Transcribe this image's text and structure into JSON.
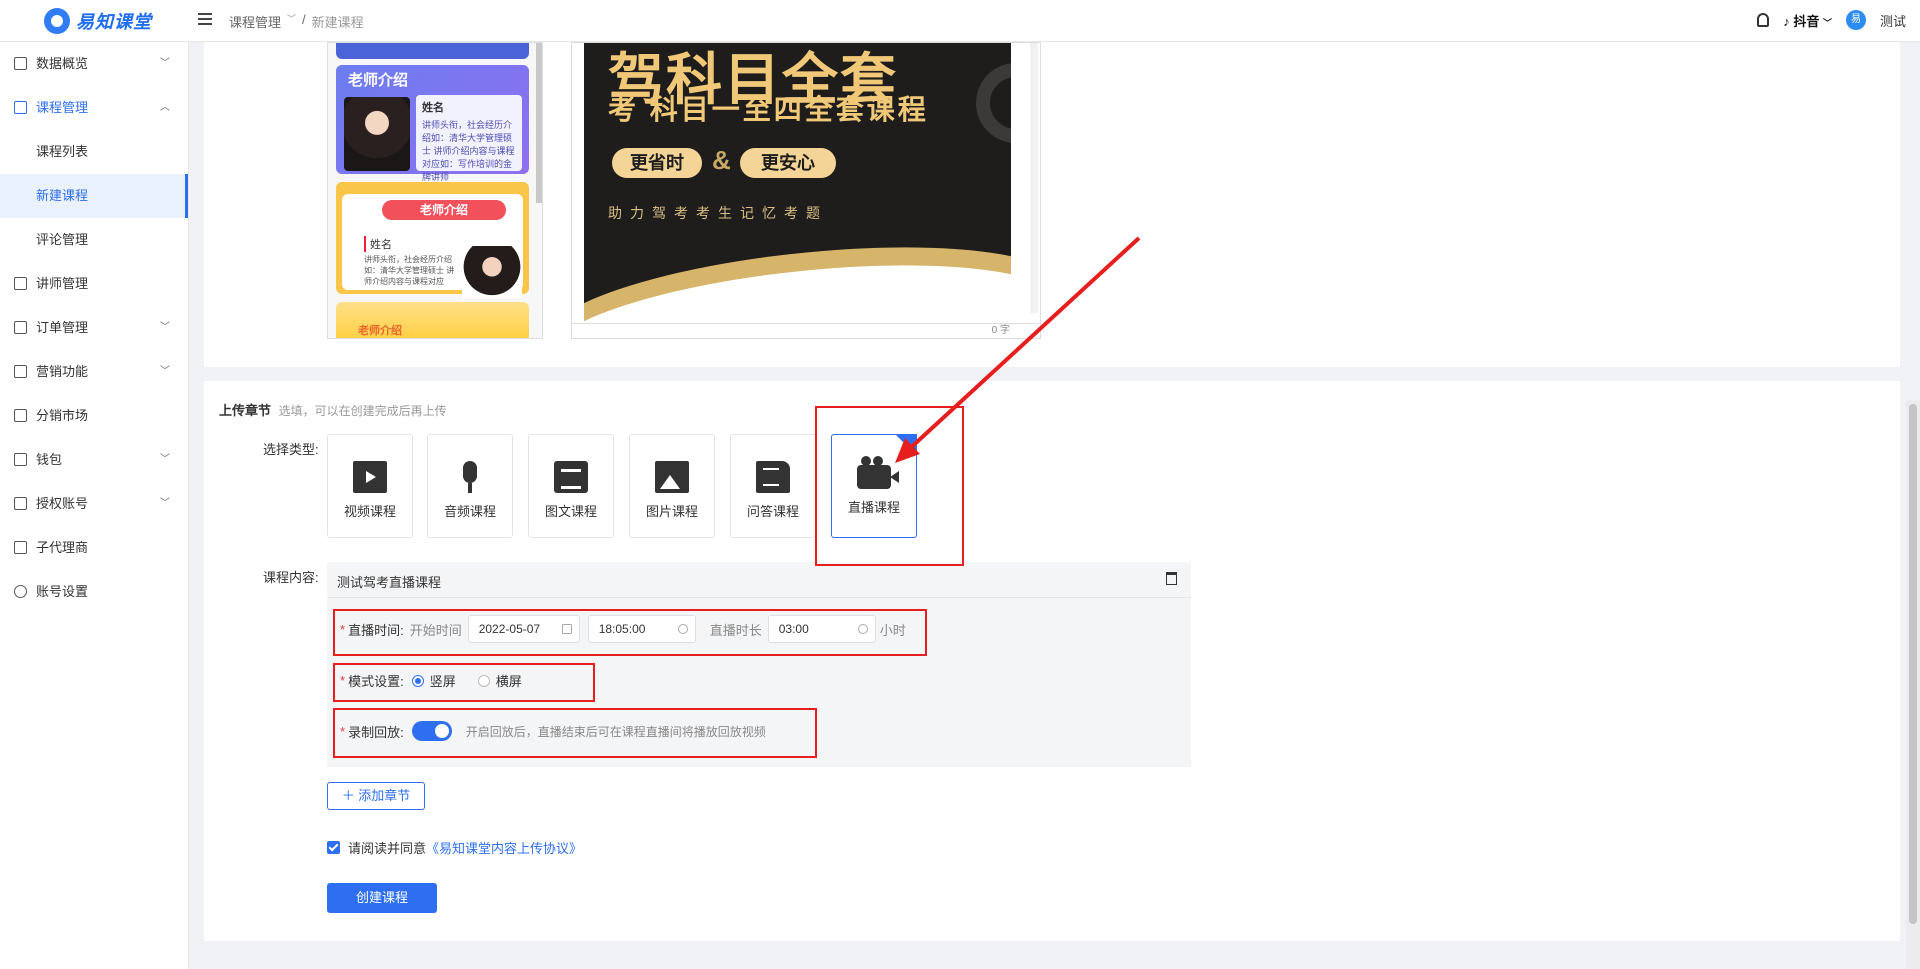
{
  "app": {
    "logo_text": "易知课堂"
  },
  "breadcrumb": {
    "parent": "课程管理",
    "separator": "/",
    "current": "新建课程"
  },
  "topbar": {
    "platform": "抖音",
    "user": "测试"
  },
  "sidebar": {
    "items": [
      {
        "label": "数据概览",
        "icon": "dashboard-icon"
      },
      {
        "label": "课程管理",
        "icon": "grid-icon",
        "active": true,
        "sub": [
          "课程列表",
          "新建课程",
          "评论管理"
        ]
      },
      {
        "label": "讲师管理",
        "icon": "teacher-icon"
      },
      {
        "label": "订单管理",
        "icon": "order-icon"
      },
      {
        "label": "营销功能",
        "icon": "marketing-icon"
      },
      {
        "label": "分销市场",
        "icon": "market-icon"
      },
      {
        "label": "钱包",
        "icon": "wallet-icon"
      },
      {
        "label": "授权账号",
        "icon": "auth-icon"
      },
      {
        "label": "子代理商",
        "icon": "agent-icon"
      },
      {
        "label": "账号设置",
        "icon": "gear-icon"
      }
    ]
  },
  "template_preview": {
    "card1_title": "老师介绍",
    "card1_name": "姓名",
    "card1_text": "讲师头衔，社会经历介绍如：清华大学管理硕士 讲师介绍内容与课程对应如：写作培训的金牌讲师",
    "card2_title": "老师介绍",
    "card2_name": "姓名",
    "card2_text": "讲师头衔，社会经历介绍如：清华大学管理硕士 讲师介绍内容与课程对应",
    "card3_title": "老师介绍"
  },
  "banner_preview": {
    "line1": "驾科目全套",
    "line2": "考 科目一至四全套课程",
    "badge1": "更省时",
    "amp": "&",
    "badge2": "更安心",
    "subtitle": "助力驾考考生记忆考题",
    "char_count": "0 字"
  },
  "upload_section": {
    "title": "上传章节",
    "hint": "选填，可以在创建完成后再上传",
    "type_label": "选择类型:",
    "types": [
      {
        "label": "视频课程",
        "icon": "video-icon"
      },
      {
        "label": "音频课程",
        "icon": "microphone-icon"
      },
      {
        "label": "图文课程",
        "icon": "article-icon"
      },
      {
        "label": "图片课程",
        "icon": "image-icon"
      },
      {
        "label": "问答课程",
        "icon": "qa-icon"
      },
      {
        "label": "直播课程",
        "icon": "live-camera-icon",
        "selected": true
      }
    ],
    "content_label": "课程内容:",
    "content_title": "测试驾考直播课程",
    "live_time_label": "直播时间:",
    "start_label": "开始时间",
    "start_date": "2022-05-07",
    "start_time": "18:05:00",
    "duration_label": "直播时长",
    "duration": "03:00",
    "duration_unit": "小时",
    "mode_label": "模式设置:",
    "mode_options": [
      "竖屏",
      "横屏"
    ],
    "mode_selected": "竖屏",
    "record_label": "录制回放:",
    "record_on": true,
    "record_hint": "开启回放后，直播结束后可在课程直播间将播放回放视频",
    "add_chapter": "＋ 添加章节",
    "agree_text": "请阅读并同意",
    "agree_link": "《易知课堂内容上传协议》",
    "create_button": "创建课程"
  },
  "accent_color": "#2d6ff0",
  "highlight_color": "#e61e1e"
}
